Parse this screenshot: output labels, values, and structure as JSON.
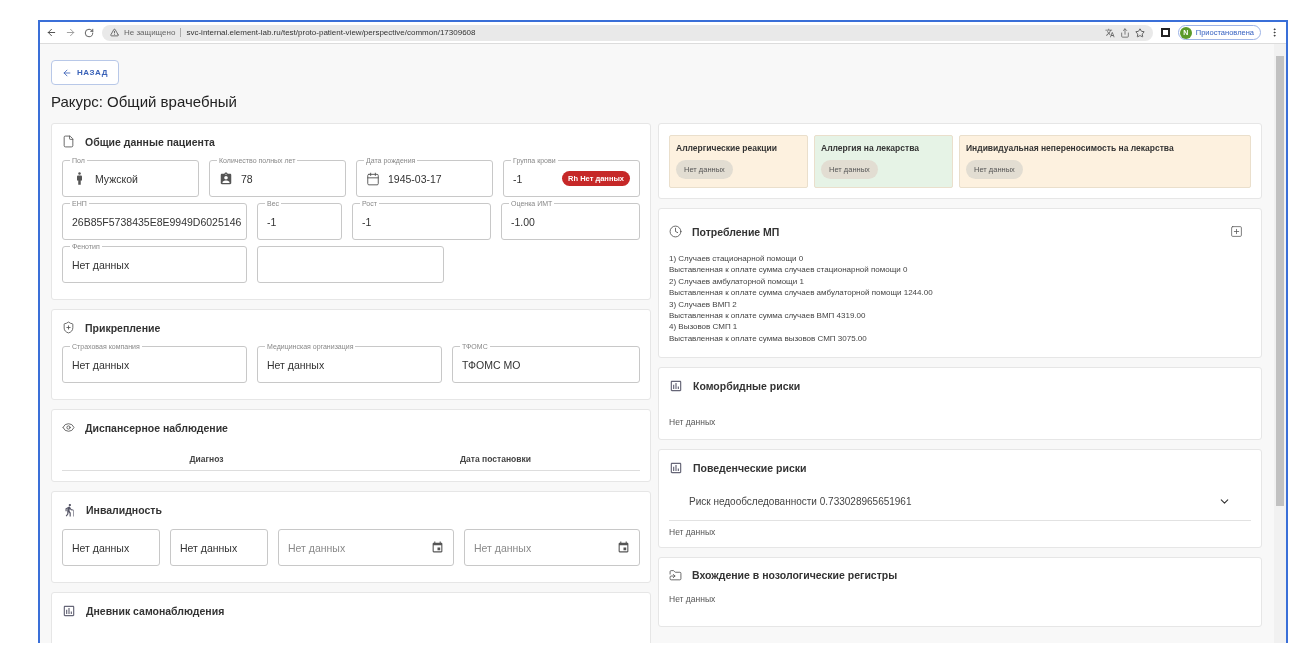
{
  "browser": {
    "security": "Не защищено",
    "url": "svc-internal.element-lab.ru/test/proto-patient-view/perspective/common/17309608",
    "profile_initial": "N",
    "profile_status": "Приостановлена"
  },
  "back_button": "НАЗАД",
  "title": "Ракурс: Общий врачебный",
  "patient_data": {
    "title": "Общие данные пациента",
    "rows": [
      [
        {
          "kind": "gender",
          "label": "Пол",
          "value": "Мужской"
        },
        {
          "kind": "age",
          "label": "Количество полных лет",
          "value": "78"
        },
        {
          "kind": "date",
          "label": "Дата рождения",
          "value": "1945-03-17"
        },
        {
          "kind": "blood",
          "label": "Группа крови",
          "value": "-1",
          "badge": "Rh Нет данных"
        }
      ],
      [
        {
          "kind": "text",
          "label": "ЕНП",
          "value": "26B85F5738435E8E9949D6025146"
        },
        {
          "kind": "text",
          "label": "Вес",
          "value": "-1"
        },
        {
          "kind": "text",
          "label": "Рост",
          "value": "-1"
        },
        {
          "kind": "text",
          "label": "Оценка ИМТ",
          "value": "-1.00"
        }
      ],
      [
        {
          "kind": "text",
          "label": "Фенотип",
          "value": "Нет данных"
        },
        {
          "kind": "empty"
        }
      ]
    ]
  },
  "attachment": {
    "title": "Прикрепление",
    "fields": [
      {
        "label": "Страховая компания",
        "value": "Нет данных"
      },
      {
        "label": "Медицинская организация",
        "value": "Нет данных"
      },
      {
        "label": "ТФОМС",
        "value": "ТФОМС МО"
      }
    ]
  },
  "dispensary": {
    "title": "Диспансерное наблюдение",
    "columns": [
      "Диагноз",
      "Дата постановки"
    ]
  },
  "disability": {
    "title": "Инвалидность",
    "fields": [
      {
        "kind": "text",
        "value": "Нет данных"
      },
      {
        "kind": "text",
        "value": "Нет данных"
      },
      {
        "kind": "date",
        "placeholder": "Нет данных"
      },
      {
        "kind": "date",
        "placeholder": "Нет данных"
      }
    ]
  },
  "diary": {
    "title": "Дневник самонаблюдения"
  },
  "allergies": [
    {
      "title": "Аллергические реакции",
      "value": "Нет данных",
      "color": "#fdf1df"
    },
    {
      "title": "Аллергия на лекарства",
      "value": "Нет данных",
      "color": "#e6f3e6"
    },
    {
      "title": "Индивидуальная непереносимость на лекарства",
      "value": "Нет данных",
      "color": "#fdf1df"
    }
  ],
  "mp_consumption": {
    "title": "Потребление МП",
    "lines": [
      "1) Случаев стационарной помощи 0",
      "Выставленная к оплате сумма случаев стационарной помощи 0",
      "2) Случаев амбулаторной помощи 1",
      "Выставленная к оплате сумма случаев амбулаторной помощи 1244.00",
      "3) Случаев ВМП 2",
      "Выставленная к оплате сумма случаев ВМП 4319.00",
      "4) Вызовов СМП 1",
      "Выставленная к оплате сумма вызовов СМП 3075.00"
    ]
  },
  "comorbid_risks": {
    "title": "Коморбидные риски",
    "text": "Нет данных"
  },
  "behavioral_risks": {
    "title": "Поведенческие риски",
    "risks": [
      {
        "label": "Риск недообследованности 0.733028965651961",
        "expanded": false
      }
    ],
    "text": "Нет данных"
  },
  "registries": {
    "title": "Вхождение в нозологические регистры",
    "text": "Нет данных"
  }
}
